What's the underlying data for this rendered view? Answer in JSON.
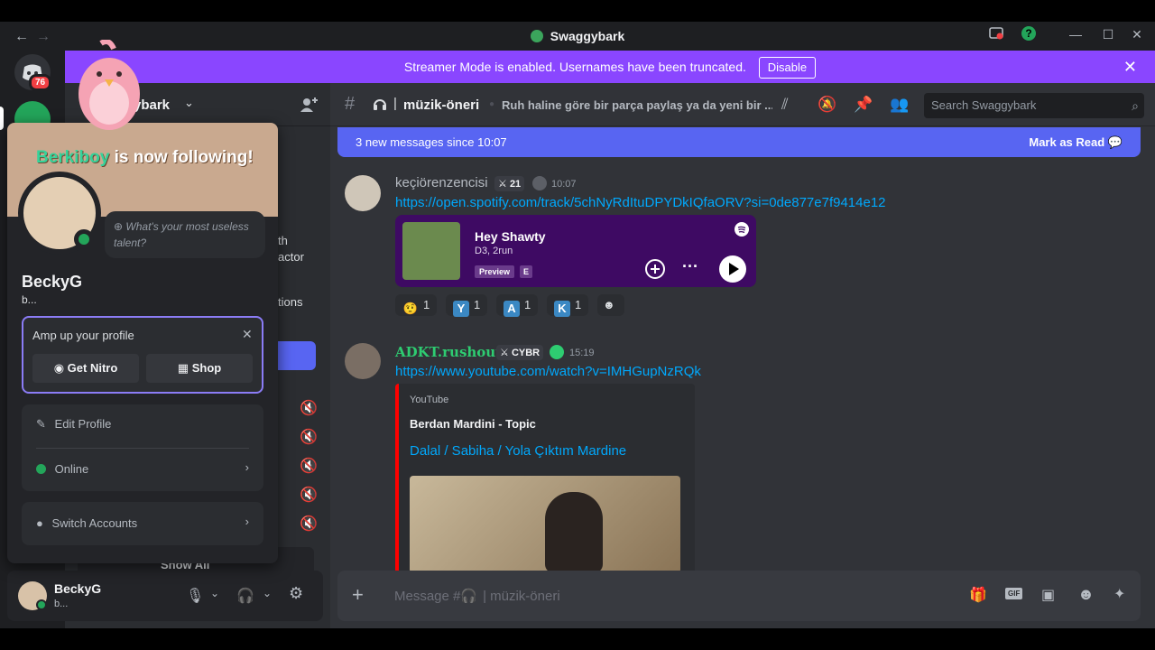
{
  "window": {
    "title": "Swaggybark"
  },
  "banner": {
    "text": "Streamer Mode is enabled. Usernames have been truncated.",
    "disable_label": "Disable"
  },
  "rail": {
    "badge_count": "76"
  },
  "server": {
    "name_fragment": "ybark"
  },
  "sidebar_fragments": [
    "th",
    "actor",
    "tions",
    "Show All"
  ],
  "channel": {
    "name": "müzik-öneri",
    "topic": "Ruh haline göre bir parça paylaş ya da yeni bir ...",
    "search_placeholder": "Search Swaggybark"
  },
  "new_messages": {
    "text": "3 new messages since 10:07",
    "mark_label": "Mark as Read"
  },
  "messages": [
    {
      "author": "keçiörenzencisi",
      "tag": "21",
      "time": "10:07",
      "link": "https://open.spotify.com/track/5chNyRdItuDPYDkIQfaORV?si=0de877e7f9414e12",
      "spotify": {
        "track": "Hey Shawty",
        "artists": "D3, 2run",
        "preview": "Preview",
        "explicit": "E"
      },
      "reactions": [
        {
          "emoji": "face",
          "count": "1"
        },
        {
          "emoji": "Y",
          "count": "1"
        },
        {
          "emoji": "A",
          "count": "1"
        },
        {
          "emoji": "K",
          "count": "1"
        }
      ]
    },
    {
      "author": "ADKT.rushout",
      "tag": "CYBR",
      "time": "15:19",
      "link": "https://www.youtube.com/watch?v=IMHGupNzRQk",
      "embed": {
        "provider": "YouTube",
        "author": "Berdan Mardini - Topic",
        "title": "Dalal / Sabiha / Yola Çıktım Mardine"
      }
    }
  ],
  "composer": {
    "placeholder_prefix": "Message #",
    "placeholder_channel": "| müzik-öneri"
  },
  "user": {
    "name": "BeckyG",
    "status": "b..."
  },
  "popout": {
    "follow_name": "Berkiboy",
    "follow_text": "is now following!",
    "bubble": "What's your most useless talent?",
    "name": "BeckyG",
    "status": "b...",
    "amp_title": "Amp up your profile",
    "nitro_label": "Get Nitro",
    "shop_label": "Shop",
    "edit_label": "Edit Profile",
    "online_label": "Online",
    "switch_label": "Switch Accounts"
  },
  "colors": {
    "accent": "#5865f2",
    "banner": "#8a46ff",
    "online": "#23a55a",
    "spotify": "#3e0a63",
    "link": "#00a8fc"
  }
}
